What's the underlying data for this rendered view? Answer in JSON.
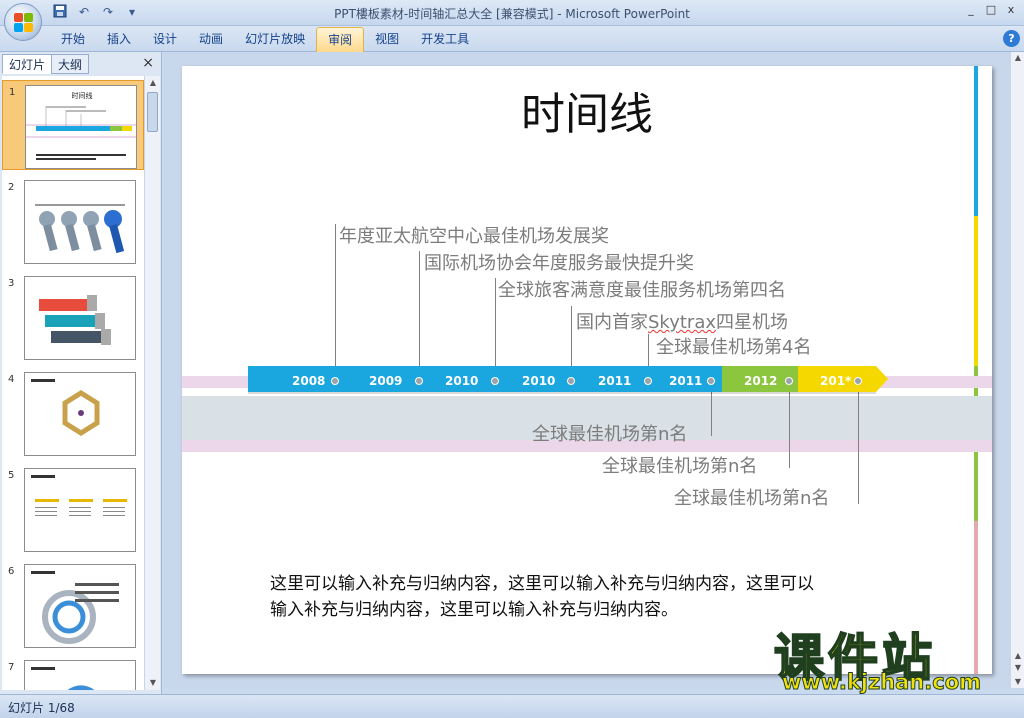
{
  "window": {
    "title": "PPT樓板素材-时间轴汇总大全 [兼容模式] - Microsoft PowerPoint",
    "qat_icons": [
      "save-icon",
      "undo-icon",
      "redo-icon",
      "customize-icon"
    ],
    "controls": [
      "_",
      "□",
      "x"
    ]
  },
  "ribbon": {
    "tabs": [
      {
        "label": "开始"
      },
      {
        "label": "插入"
      },
      {
        "label": "设计"
      },
      {
        "label": "动画"
      },
      {
        "label": "幻灯片放映"
      },
      {
        "label": "审阅",
        "active": true
      },
      {
        "label": "视图"
      },
      {
        "label": "开发工具"
      }
    ],
    "help": "?"
  },
  "pane": {
    "tabs": [
      "幻灯片",
      "大纲"
    ],
    "close": "×",
    "slides": [
      {
        "num": "1",
        "selected": true
      },
      {
        "num": "2"
      },
      {
        "num": "3"
      },
      {
        "num": "4"
      },
      {
        "num": "5"
      },
      {
        "num": "6"
      },
      {
        "num": "7"
      }
    ]
  },
  "slide": {
    "title": "时间线",
    "timeline": {
      "segments": [
        {
          "label": "2008",
          "color": "#1aa7e0"
        },
        {
          "label": "2009",
          "color": "#1aa7e0"
        },
        {
          "label": "2010",
          "color": "#1aa7e0"
        },
        {
          "label": "2010",
          "color": "#1aa7e0"
        },
        {
          "label": "2011",
          "color": "#1aa7e0"
        },
        {
          "label": "2011",
          "color": "#1aa7e0"
        },
        {
          "label": "2012",
          "color": "#8cc63f"
        },
        {
          "label": "201*",
          "color": "#f5d800"
        }
      ]
    },
    "annotations_top": [
      "年度亚太航空中心最佳机场发展奖",
      "国际机场协会年度服务最快提升奖",
      "全球旅客满意度最佳服务机场第四名",
      "国内首家",
      "Skytrax",
      "四星机场",
      "全球最佳机场第4名"
    ],
    "annotations_bottom": [
      "全球最佳机场第n名",
      "全球最佳机场第n名",
      "全球最佳机场第n名"
    ],
    "body_line1": "这里可以输入补充与归纳内容，这里可以输入补充与归纳内容，这里可以",
    "body_line2": "输入补充与归纳内容，这里可以输入补充与归纳内容。"
  },
  "status": {
    "slide_counter": "幻灯片 1/68"
  },
  "watermark": {
    "main": "课件站",
    "url": "www.kjzhan.com"
  },
  "colors": {
    "blue": "#1aa7e0",
    "green": "#8cc63f",
    "yellow": "#f5d800",
    "pink_band": "#ecd6ea"
  }
}
